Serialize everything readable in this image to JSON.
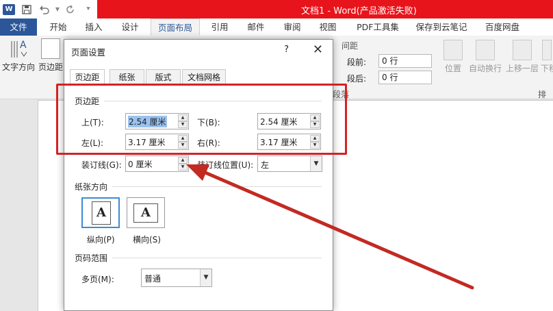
{
  "app": {
    "window_title": "文档1 - Word(产品激活失败)",
    "logo_letter": "W",
    "qat_icons": [
      "save-icon",
      "undo-icon",
      "redo-icon"
    ]
  },
  "tabs": [
    {
      "label": "文件"
    },
    {
      "label": "开始"
    },
    {
      "label": "插入"
    },
    {
      "label": "设计"
    },
    {
      "label": "页面布局"
    },
    {
      "label": "引用"
    },
    {
      "label": "邮件"
    },
    {
      "label": "审阅"
    },
    {
      "label": "视图"
    },
    {
      "label": "PDF工具集"
    },
    {
      "label": "保存到云笔记"
    },
    {
      "label": "百度网盘"
    }
  ],
  "ribbon": {
    "text_direction": "文字方向",
    "margins": "页边距",
    "spacing_group": "间距",
    "before_label": "段前:",
    "before_value": "0 行",
    "after_label": "段后:",
    "after_value": "0 行",
    "paragraph_group": "段落",
    "position": "位置",
    "wrap_text": "自动换行",
    "bring_forward": "上移一层",
    "send_backward": "下移",
    "arrange_group": "排列"
  },
  "dialog": {
    "title": "页面设置",
    "help": "?",
    "close": "✕",
    "tabs": [
      "页边距",
      "纸张",
      "版式",
      "文档网格"
    ],
    "margins_section": "页边距",
    "top_label": "上(T):",
    "top_value": "2.54 厘米",
    "bottom_label": "下(B):",
    "bottom_value": "2.54 厘米",
    "left_label": "左(L):",
    "left_value": "3.17 厘米",
    "right_label": "右(R):",
    "right_value": "3.17 厘米",
    "gutter_label": "装订线(G):",
    "gutter_value": "0 厘米",
    "gutter_pos_label": "装订线位置(U):",
    "gutter_pos_value": "左",
    "orientation_section": "纸张方向",
    "portrait_label": "纵向(P)",
    "landscape_label": "横向(S)",
    "pages_section": "页码范围",
    "multiple_pages_label": "多页(M):",
    "multiple_pages_value": "普通"
  },
  "colors": {
    "title_bar": "#e8141b",
    "word_blue": "#2b579a",
    "annotation": "#c22a22"
  }
}
